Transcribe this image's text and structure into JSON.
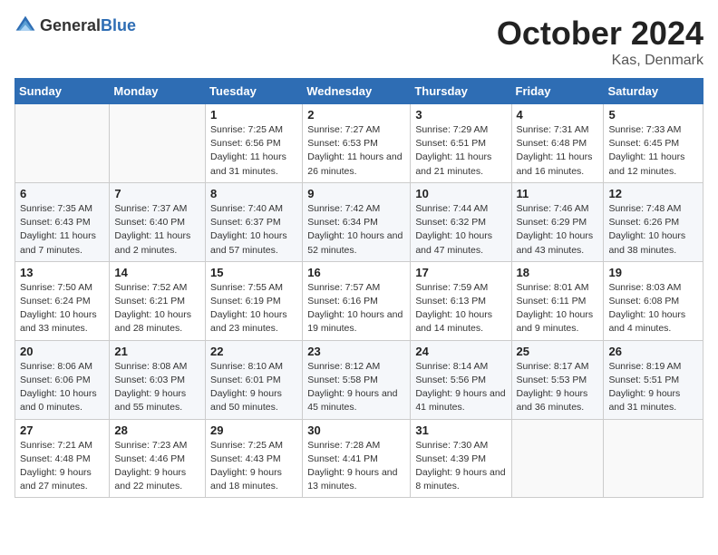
{
  "header": {
    "logo_general": "General",
    "logo_blue": "Blue",
    "month_title": "October 2024",
    "location": "Kas, Denmark"
  },
  "days_of_week": [
    "Sunday",
    "Monday",
    "Tuesday",
    "Wednesday",
    "Thursday",
    "Friday",
    "Saturday"
  ],
  "weeks": [
    [
      {
        "day": "",
        "info": ""
      },
      {
        "day": "",
        "info": ""
      },
      {
        "day": "1",
        "info": "Sunrise: 7:25 AM\nSunset: 6:56 PM\nDaylight: 11 hours and 31 minutes."
      },
      {
        "day": "2",
        "info": "Sunrise: 7:27 AM\nSunset: 6:53 PM\nDaylight: 11 hours and 26 minutes."
      },
      {
        "day": "3",
        "info": "Sunrise: 7:29 AM\nSunset: 6:51 PM\nDaylight: 11 hours and 21 minutes."
      },
      {
        "day": "4",
        "info": "Sunrise: 7:31 AM\nSunset: 6:48 PM\nDaylight: 11 hours and 16 minutes."
      },
      {
        "day": "5",
        "info": "Sunrise: 7:33 AM\nSunset: 6:45 PM\nDaylight: 11 hours and 12 minutes."
      }
    ],
    [
      {
        "day": "6",
        "info": "Sunrise: 7:35 AM\nSunset: 6:43 PM\nDaylight: 11 hours and 7 minutes."
      },
      {
        "day": "7",
        "info": "Sunrise: 7:37 AM\nSunset: 6:40 PM\nDaylight: 11 hours and 2 minutes."
      },
      {
        "day": "8",
        "info": "Sunrise: 7:40 AM\nSunset: 6:37 PM\nDaylight: 10 hours and 57 minutes."
      },
      {
        "day": "9",
        "info": "Sunrise: 7:42 AM\nSunset: 6:34 PM\nDaylight: 10 hours and 52 minutes."
      },
      {
        "day": "10",
        "info": "Sunrise: 7:44 AM\nSunset: 6:32 PM\nDaylight: 10 hours and 47 minutes."
      },
      {
        "day": "11",
        "info": "Sunrise: 7:46 AM\nSunset: 6:29 PM\nDaylight: 10 hours and 43 minutes."
      },
      {
        "day": "12",
        "info": "Sunrise: 7:48 AM\nSunset: 6:26 PM\nDaylight: 10 hours and 38 minutes."
      }
    ],
    [
      {
        "day": "13",
        "info": "Sunrise: 7:50 AM\nSunset: 6:24 PM\nDaylight: 10 hours and 33 minutes."
      },
      {
        "day": "14",
        "info": "Sunrise: 7:52 AM\nSunset: 6:21 PM\nDaylight: 10 hours and 28 minutes."
      },
      {
        "day": "15",
        "info": "Sunrise: 7:55 AM\nSunset: 6:19 PM\nDaylight: 10 hours and 23 minutes."
      },
      {
        "day": "16",
        "info": "Sunrise: 7:57 AM\nSunset: 6:16 PM\nDaylight: 10 hours and 19 minutes."
      },
      {
        "day": "17",
        "info": "Sunrise: 7:59 AM\nSunset: 6:13 PM\nDaylight: 10 hours and 14 minutes."
      },
      {
        "day": "18",
        "info": "Sunrise: 8:01 AM\nSunset: 6:11 PM\nDaylight: 10 hours and 9 minutes."
      },
      {
        "day": "19",
        "info": "Sunrise: 8:03 AM\nSunset: 6:08 PM\nDaylight: 10 hours and 4 minutes."
      }
    ],
    [
      {
        "day": "20",
        "info": "Sunrise: 8:06 AM\nSunset: 6:06 PM\nDaylight: 10 hours and 0 minutes."
      },
      {
        "day": "21",
        "info": "Sunrise: 8:08 AM\nSunset: 6:03 PM\nDaylight: 9 hours and 55 minutes."
      },
      {
        "day": "22",
        "info": "Sunrise: 8:10 AM\nSunset: 6:01 PM\nDaylight: 9 hours and 50 minutes."
      },
      {
        "day": "23",
        "info": "Sunrise: 8:12 AM\nSunset: 5:58 PM\nDaylight: 9 hours and 45 minutes."
      },
      {
        "day": "24",
        "info": "Sunrise: 8:14 AM\nSunset: 5:56 PM\nDaylight: 9 hours and 41 minutes."
      },
      {
        "day": "25",
        "info": "Sunrise: 8:17 AM\nSunset: 5:53 PM\nDaylight: 9 hours and 36 minutes."
      },
      {
        "day": "26",
        "info": "Sunrise: 8:19 AM\nSunset: 5:51 PM\nDaylight: 9 hours and 31 minutes."
      }
    ],
    [
      {
        "day": "27",
        "info": "Sunrise: 7:21 AM\nSunset: 4:48 PM\nDaylight: 9 hours and 27 minutes."
      },
      {
        "day": "28",
        "info": "Sunrise: 7:23 AM\nSunset: 4:46 PM\nDaylight: 9 hours and 22 minutes."
      },
      {
        "day": "29",
        "info": "Sunrise: 7:25 AM\nSunset: 4:43 PM\nDaylight: 9 hours and 18 minutes."
      },
      {
        "day": "30",
        "info": "Sunrise: 7:28 AM\nSunset: 4:41 PM\nDaylight: 9 hours and 13 minutes."
      },
      {
        "day": "31",
        "info": "Sunrise: 7:30 AM\nSunset: 4:39 PM\nDaylight: 9 hours and 8 minutes."
      },
      {
        "day": "",
        "info": ""
      },
      {
        "day": "",
        "info": ""
      }
    ]
  ]
}
